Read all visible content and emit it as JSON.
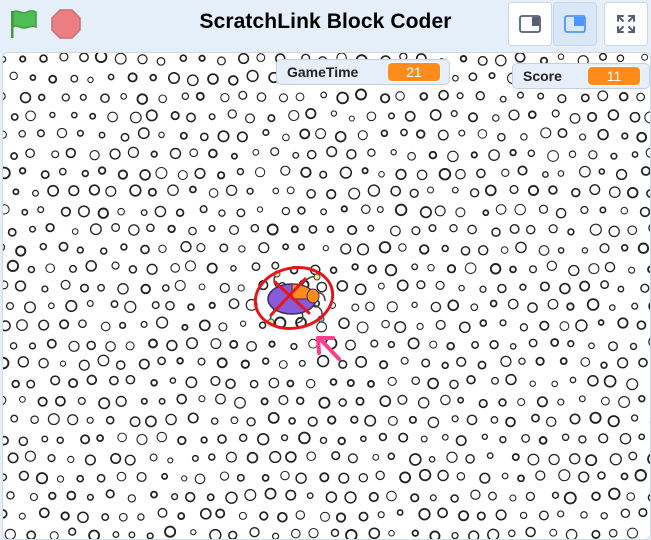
{
  "app": {
    "title": "ScratchLink Block Coder"
  },
  "toolbar": {
    "green_flag_icon": "green-flag-icon",
    "stop_icon": "stop-sign-icon",
    "small_stage_icon": "small-stage-layout-icon",
    "normal_stage_icon": "normal-stage-layout-icon",
    "fullscreen_icon": "fullscreen-icon"
  },
  "monitors": {
    "gametime": {
      "label": "GameTime",
      "value": "21"
    },
    "score": {
      "label": "Score",
      "value": "11"
    }
  },
  "colors": {
    "flag_green": "#4cbf56",
    "stop_red": "#ec5959",
    "monitor_value": "#ff8c1a",
    "annotation_red": "#e8141b",
    "annotation_pink": "#ff3f8e"
  }
}
